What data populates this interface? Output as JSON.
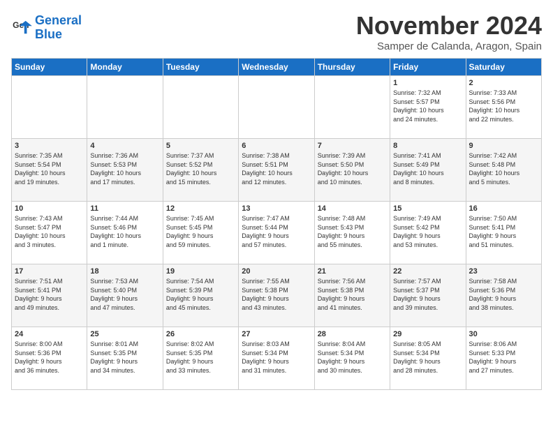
{
  "logo": {
    "line1": "General",
    "line2": "Blue"
  },
  "title": "November 2024",
  "location": "Samper de Calanda, Aragon, Spain",
  "weekdays": [
    "Sunday",
    "Monday",
    "Tuesday",
    "Wednesday",
    "Thursday",
    "Friday",
    "Saturday"
  ],
  "weeks": [
    [
      {
        "day": "",
        "content": ""
      },
      {
        "day": "",
        "content": ""
      },
      {
        "day": "",
        "content": ""
      },
      {
        "day": "",
        "content": ""
      },
      {
        "day": "",
        "content": ""
      },
      {
        "day": "1",
        "content": "Sunrise: 7:32 AM\nSunset: 5:57 PM\nDaylight: 10 hours\nand 24 minutes."
      },
      {
        "day": "2",
        "content": "Sunrise: 7:33 AM\nSunset: 5:56 PM\nDaylight: 10 hours\nand 22 minutes."
      }
    ],
    [
      {
        "day": "3",
        "content": "Sunrise: 7:35 AM\nSunset: 5:54 PM\nDaylight: 10 hours\nand 19 minutes."
      },
      {
        "day": "4",
        "content": "Sunrise: 7:36 AM\nSunset: 5:53 PM\nDaylight: 10 hours\nand 17 minutes."
      },
      {
        "day": "5",
        "content": "Sunrise: 7:37 AM\nSunset: 5:52 PM\nDaylight: 10 hours\nand 15 minutes."
      },
      {
        "day": "6",
        "content": "Sunrise: 7:38 AM\nSunset: 5:51 PM\nDaylight: 10 hours\nand 12 minutes."
      },
      {
        "day": "7",
        "content": "Sunrise: 7:39 AM\nSunset: 5:50 PM\nDaylight: 10 hours\nand 10 minutes."
      },
      {
        "day": "8",
        "content": "Sunrise: 7:41 AM\nSunset: 5:49 PM\nDaylight: 10 hours\nand 8 minutes."
      },
      {
        "day": "9",
        "content": "Sunrise: 7:42 AM\nSunset: 5:48 PM\nDaylight: 10 hours\nand 5 minutes."
      }
    ],
    [
      {
        "day": "10",
        "content": "Sunrise: 7:43 AM\nSunset: 5:47 PM\nDaylight: 10 hours\nand 3 minutes."
      },
      {
        "day": "11",
        "content": "Sunrise: 7:44 AM\nSunset: 5:46 PM\nDaylight: 10 hours\nand 1 minute."
      },
      {
        "day": "12",
        "content": "Sunrise: 7:45 AM\nSunset: 5:45 PM\nDaylight: 9 hours\nand 59 minutes."
      },
      {
        "day": "13",
        "content": "Sunrise: 7:47 AM\nSunset: 5:44 PM\nDaylight: 9 hours\nand 57 minutes."
      },
      {
        "day": "14",
        "content": "Sunrise: 7:48 AM\nSunset: 5:43 PM\nDaylight: 9 hours\nand 55 minutes."
      },
      {
        "day": "15",
        "content": "Sunrise: 7:49 AM\nSunset: 5:42 PM\nDaylight: 9 hours\nand 53 minutes."
      },
      {
        "day": "16",
        "content": "Sunrise: 7:50 AM\nSunset: 5:41 PM\nDaylight: 9 hours\nand 51 minutes."
      }
    ],
    [
      {
        "day": "17",
        "content": "Sunrise: 7:51 AM\nSunset: 5:41 PM\nDaylight: 9 hours\nand 49 minutes."
      },
      {
        "day": "18",
        "content": "Sunrise: 7:53 AM\nSunset: 5:40 PM\nDaylight: 9 hours\nand 47 minutes."
      },
      {
        "day": "19",
        "content": "Sunrise: 7:54 AM\nSunset: 5:39 PM\nDaylight: 9 hours\nand 45 minutes."
      },
      {
        "day": "20",
        "content": "Sunrise: 7:55 AM\nSunset: 5:38 PM\nDaylight: 9 hours\nand 43 minutes."
      },
      {
        "day": "21",
        "content": "Sunrise: 7:56 AM\nSunset: 5:38 PM\nDaylight: 9 hours\nand 41 minutes."
      },
      {
        "day": "22",
        "content": "Sunrise: 7:57 AM\nSunset: 5:37 PM\nDaylight: 9 hours\nand 39 minutes."
      },
      {
        "day": "23",
        "content": "Sunrise: 7:58 AM\nSunset: 5:36 PM\nDaylight: 9 hours\nand 38 minutes."
      }
    ],
    [
      {
        "day": "24",
        "content": "Sunrise: 8:00 AM\nSunset: 5:36 PM\nDaylight: 9 hours\nand 36 minutes."
      },
      {
        "day": "25",
        "content": "Sunrise: 8:01 AM\nSunset: 5:35 PM\nDaylight: 9 hours\nand 34 minutes."
      },
      {
        "day": "26",
        "content": "Sunrise: 8:02 AM\nSunset: 5:35 PM\nDaylight: 9 hours\nand 33 minutes."
      },
      {
        "day": "27",
        "content": "Sunrise: 8:03 AM\nSunset: 5:34 PM\nDaylight: 9 hours\nand 31 minutes."
      },
      {
        "day": "28",
        "content": "Sunrise: 8:04 AM\nSunset: 5:34 PM\nDaylight: 9 hours\nand 30 minutes."
      },
      {
        "day": "29",
        "content": "Sunrise: 8:05 AM\nSunset: 5:34 PM\nDaylight: 9 hours\nand 28 minutes."
      },
      {
        "day": "30",
        "content": "Sunrise: 8:06 AM\nSunset: 5:33 PM\nDaylight: 9 hours\nand 27 minutes."
      }
    ]
  ]
}
